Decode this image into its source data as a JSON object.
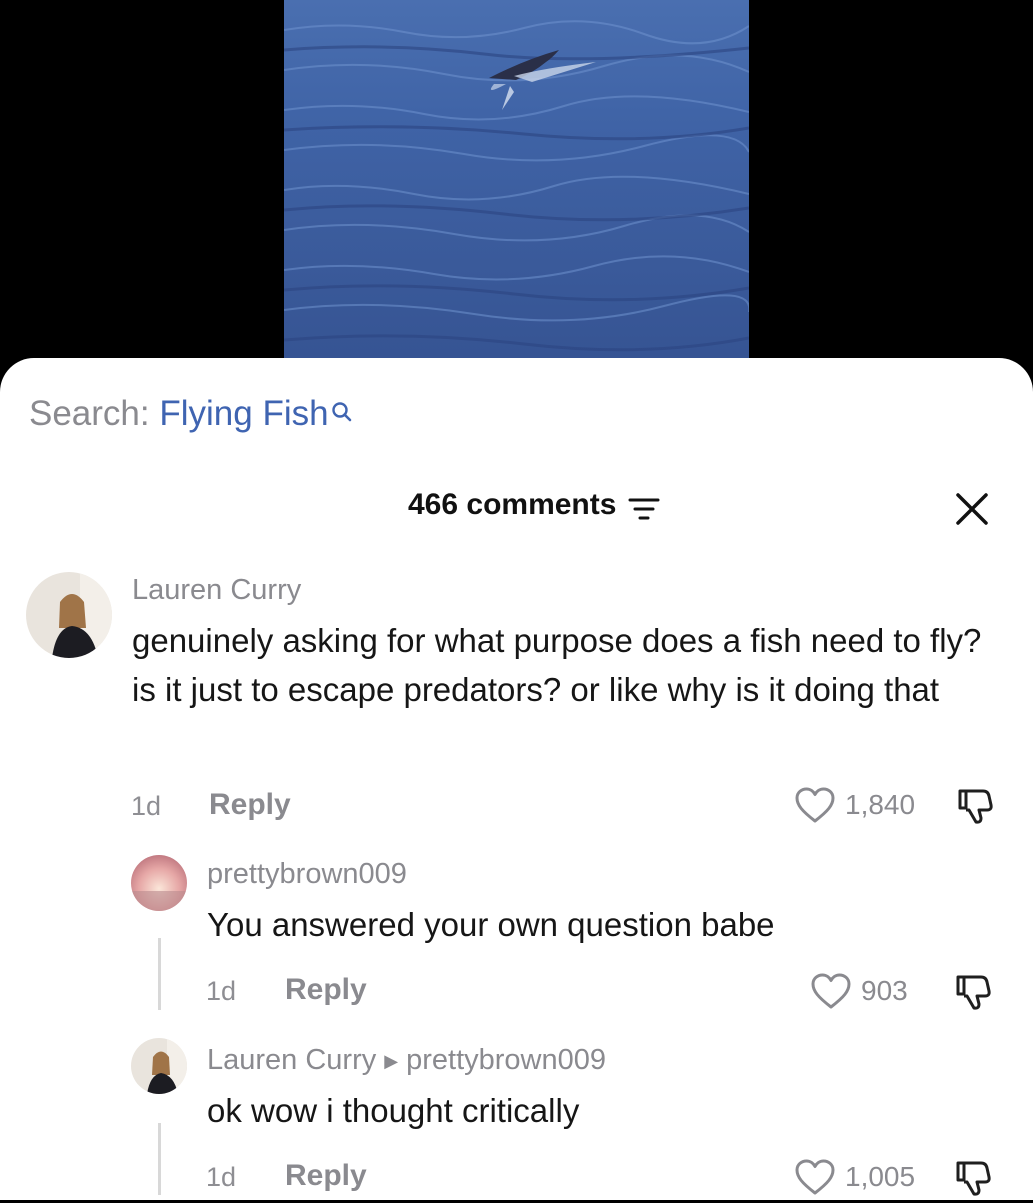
{
  "search": {
    "label": "Search:",
    "query": "Flying Fish"
  },
  "header": {
    "comments_count": "466 comments"
  },
  "comments": [
    {
      "author": "Lauren Curry",
      "text": "genuinely asking for what purpose does a fish need to fly? is it just to escape predators? or like why is it doing that",
      "time": "1d",
      "reply_label": "Reply",
      "likes": "1,840"
    },
    {
      "author": "prettybrown009",
      "text": "You answered your own question babe",
      "time": "1d",
      "reply_label": "Reply",
      "likes": "903"
    },
    {
      "author": "Lauren Curry",
      "reply_to": "prettybrown009",
      "text": "ok wow i thought critically",
      "time": "1d",
      "reply_label": "Reply",
      "likes": "1,005"
    }
  ],
  "colors": {
    "accent_link": "#3f64b1",
    "muted": "#8a8a8f",
    "text": "#161616"
  }
}
